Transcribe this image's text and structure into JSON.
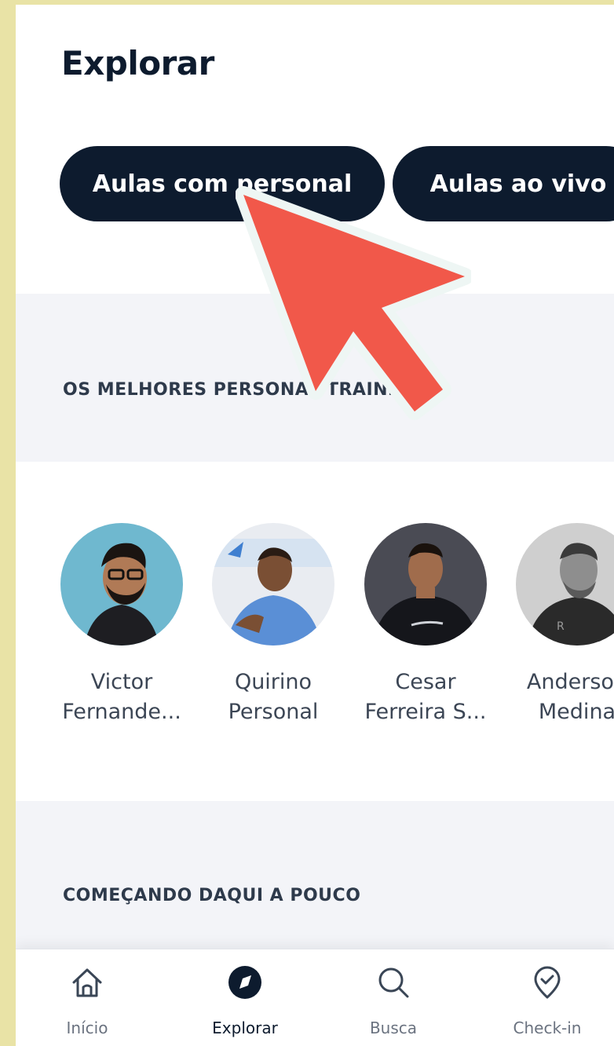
{
  "header": {
    "title": "Explorar"
  },
  "chips": [
    {
      "label": "Aulas com personal"
    },
    {
      "label": "Aulas ao vivo"
    }
  ],
  "sections": {
    "trainers_title": "OS MELHORES PERSONAL TRAINERS",
    "upcoming_title": "COMEÇANDO DAQUI A POUCO"
  },
  "trainers": [
    {
      "line1": "Victor",
      "line2": "Fernande..."
    },
    {
      "line1": "Quirino",
      "line2": "Personal"
    },
    {
      "line1": "Cesar",
      "line2": "Ferreira S..."
    },
    {
      "line1": "Anderson",
      "line2": "Medina"
    }
  ],
  "nav": [
    {
      "label": "Início",
      "icon": "home-icon"
    },
    {
      "label": "Explorar",
      "icon": "compass-icon",
      "active": true
    },
    {
      "label": "Busca",
      "icon": "search-icon"
    },
    {
      "label": "Check-in",
      "icon": "location-check-icon"
    }
  ],
  "colors": {
    "primary": "#0d1b2e",
    "section_bg": "#f3f4f8",
    "outer_bg": "#e9e3a6",
    "cursor": "#f1584a"
  }
}
